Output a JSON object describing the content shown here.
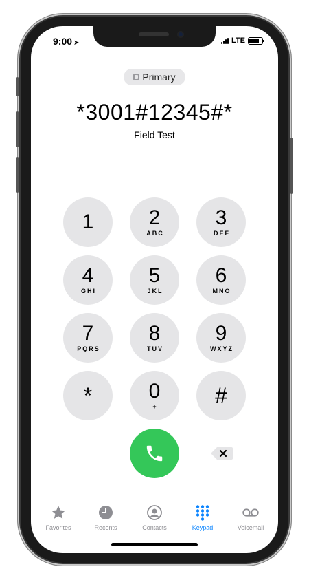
{
  "status": {
    "time": "9:00",
    "carrier": "LTE"
  },
  "line": {
    "label": "Primary"
  },
  "dialer": {
    "number": "*3001#12345#*",
    "caption": "Field Test"
  },
  "keys": [
    {
      "digit": "1",
      "letters": ""
    },
    {
      "digit": "2",
      "letters": "ABC"
    },
    {
      "digit": "3",
      "letters": "DEF"
    },
    {
      "digit": "4",
      "letters": "GHI"
    },
    {
      "digit": "5",
      "letters": "JKL"
    },
    {
      "digit": "6",
      "letters": "MNO"
    },
    {
      "digit": "7",
      "letters": "PQRS"
    },
    {
      "digit": "8",
      "letters": "TUV"
    },
    {
      "digit": "9",
      "letters": "WXYZ"
    },
    {
      "digit": "*",
      "letters": ""
    },
    {
      "digit": "0",
      "letters": "+"
    },
    {
      "digit": "#",
      "letters": ""
    }
  ],
  "tabs": [
    {
      "label": "Favorites",
      "icon": "star-icon",
      "active": false
    },
    {
      "label": "Recents",
      "icon": "clock-icon",
      "active": false
    },
    {
      "label": "Contacts",
      "icon": "person-circle-icon",
      "active": false
    },
    {
      "label": "Keypad",
      "icon": "keypad-grid-icon",
      "active": true
    },
    {
      "label": "Voicemail",
      "icon": "voicemail-icon",
      "active": false
    }
  ],
  "colors": {
    "call": "#34c759",
    "active_tab": "#0a84ff",
    "inactive_tab": "#8e8e93",
    "key_bg": "#e5e5e7"
  }
}
